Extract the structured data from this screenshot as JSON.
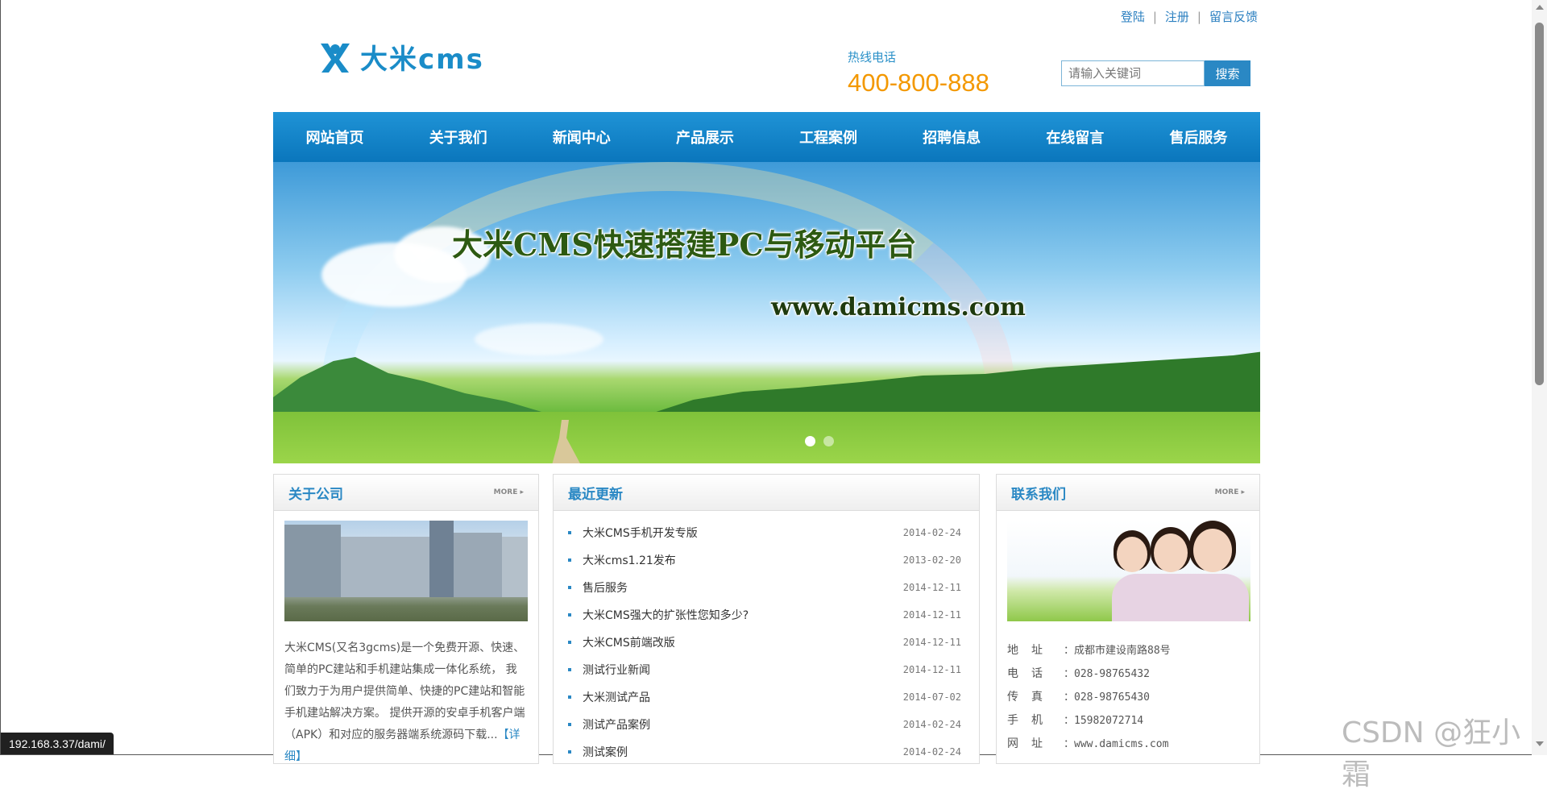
{
  "top_links": {
    "login": "登陆",
    "register": "注册",
    "feedback": "留言反馈",
    "sep": "|"
  },
  "logo": {
    "text": "大米cms",
    "icon": "dami-logo-icon"
  },
  "hotline": {
    "label": "热线电话",
    "number": "400-800-888"
  },
  "search": {
    "placeholder": "请输入关键词",
    "button": "搜索"
  },
  "nav": [
    "网站首页",
    "关于我们",
    "新闻中心",
    "产品展示",
    "工程案例",
    "招聘信息",
    "在线留言",
    "售后服务"
  ],
  "banner": {
    "title": "大米CMS快速搭建PC与移动平台",
    "url": "www.damicms.com",
    "active_slide": 1,
    "slide_count": 2
  },
  "about": {
    "title": "关于公司",
    "more": "MORE ▸",
    "text": "大米CMS(又名3gcms)是一个免费开源、快速、简单的PC建站和手机建站集成一体化系统， 我们致力于为用户提供简单、快捷的PC建站和智能手机建站解决方案。 提供开源的安卓手机客户端（APK）和对应的服务器端系统源码下载...",
    "detail": "【详细】"
  },
  "news": {
    "title": "最近更新",
    "items": [
      {
        "title": "大米CMS手机开发专版",
        "date": "2014-02-24"
      },
      {
        "title": "大米cms1.21发布",
        "date": "2013-02-20"
      },
      {
        "title": "售后服务",
        "date": "2014-12-11"
      },
      {
        "title": "大米CMS强大的扩张性您知多少?",
        "date": "2014-12-11"
      },
      {
        "title": "大米CMS前端改版",
        "date": "2014-12-11"
      },
      {
        "title": "测试行业新闻",
        "date": "2014-12-11"
      },
      {
        "title": "大米测试产品",
        "date": "2014-07-02"
      },
      {
        "title": "测试产品案例",
        "date": "2014-02-24"
      },
      {
        "title": "测试案例",
        "date": "2014-02-24"
      }
    ]
  },
  "contact": {
    "title": "联系我们",
    "more": "MORE ▸",
    "rows": [
      {
        "k": "地址",
        "v": "：成都市建设南路88号"
      },
      {
        "k": "电话",
        "v": "：028-98765432"
      },
      {
        "k": "传真",
        "v": "：028-98765430"
      },
      {
        "k": "手机",
        "v": "：15982072714"
      },
      {
        "k": "网址",
        "v": "：www.damicms.com"
      }
    ]
  },
  "status_bar": "192.168.3.37/dami/",
  "watermark": "CSDN @狂小霜",
  "colors": {
    "accent": "#2a88c4",
    "hotline": "#f39800",
    "nav": "#0a76bc"
  }
}
